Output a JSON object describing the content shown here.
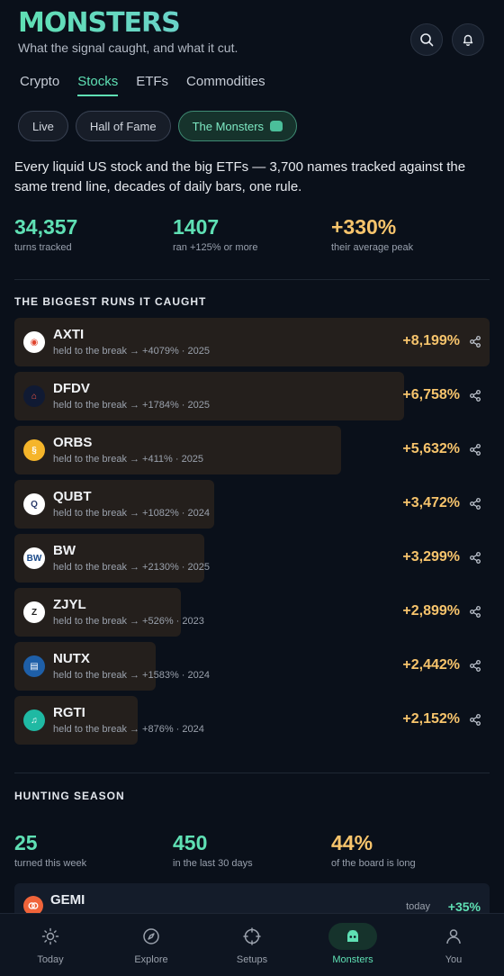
{
  "header": {
    "title": "MONSTERS",
    "tagline": "What the signal caught, and what it cut."
  },
  "tabs": [
    {
      "label": "Crypto",
      "active": false
    },
    {
      "label": "Stocks",
      "active": true
    },
    {
      "label": "ETFs",
      "active": false
    },
    {
      "label": "Commodities",
      "active": false
    }
  ],
  "pills": [
    {
      "label": "Live",
      "active": false
    },
    {
      "label": "Hall of Fame",
      "active": false
    },
    {
      "label": "The Monsters",
      "active": true
    }
  ],
  "intro": "Every liquid US stock and the big ETFs — 3,700 names tracked against the same trend line, decades of daily bars, one rule.",
  "stats": [
    {
      "value": "34,357",
      "label": "turns tracked"
    },
    {
      "value": "1407",
      "label": "ran +125% or more"
    },
    {
      "value": "+330%",
      "label": "their average peak"
    }
  ],
  "runs_section": "THE BIGGEST RUNS IT CAUGHT",
  "runs": [
    {
      "ticker": "AXTI",
      "sub": "held to the break → +4079% · 2025",
      "pct": "+8,199%",
      "bar": 1.0
    },
    {
      "ticker": "DFDV",
      "sub": "held to the break → +1784% · 2025",
      "pct": "+6,758%",
      "bar": 0.82
    },
    {
      "ticker": "ORBS",
      "sub": "held to the break → +411% · 2025",
      "pct": "+5,632%",
      "bar": 0.688
    },
    {
      "ticker": "QUBT",
      "sub": "held to the break → +1082% · 2024",
      "pct": "+3,472%",
      "bar": 0.42
    },
    {
      "ticker": "BW",
      "sub": "held to the break → +2130% · 2025",
      "pct": "+3,299%",
      "bar": 0.4
    },
    {
      "ticker": "ZJYL",
      "sub": "held to the break → +526% · 2023",
      "pct": "+2,899%",
      "bar": 0.35
    },
    {
      "ticker": "NUTX",
      "sub": "held to the break → +1583% · 2024",
      "pct": "+2,442%",
      "bar": 0.298
    },
    {
      "ticker": "RGTI",
      "sub": "held to the break → +876% · 2024",
      "pct": "+2,152%",
      "bar": 0.26
    }
  ],
  "hunt_section": "HUNTING SEASON",
  "hunt_stats": [
    {
      "value": "25",
      "label": "turned this week"
    },
    {
      "value": "450",
      "label": "in the last 30 days"
    },
    {
      "value": "44%",
      "label": "of the board is long"
    }
  ],
  "hunt_card": {
    "ticker": "GEMI",
    "when": "today",
    "pct": "+35%"
  },
  "nav": [
    {
      "label": "Today",
      "icon": "sun-icon",
      "active": false
    },
    {
      "label": "Explore",
      "icon": "compass-icon",
      "active": false
    },
    {
      "label": "Setups",
      "icon": "crosshair-icon",
      "active": false
    },
    {
      "label": "Monsters",
      "icon": "monster-icon",
      "active": true
    },
    {
      "label": "You",
      "icon": "user-icon",
      "active": false
    }
  ],
  "colors": {
    "accent": "#5fe0b4",
    "gold": "#f7c46c",
    "background": "#0a101a"
  }
}
